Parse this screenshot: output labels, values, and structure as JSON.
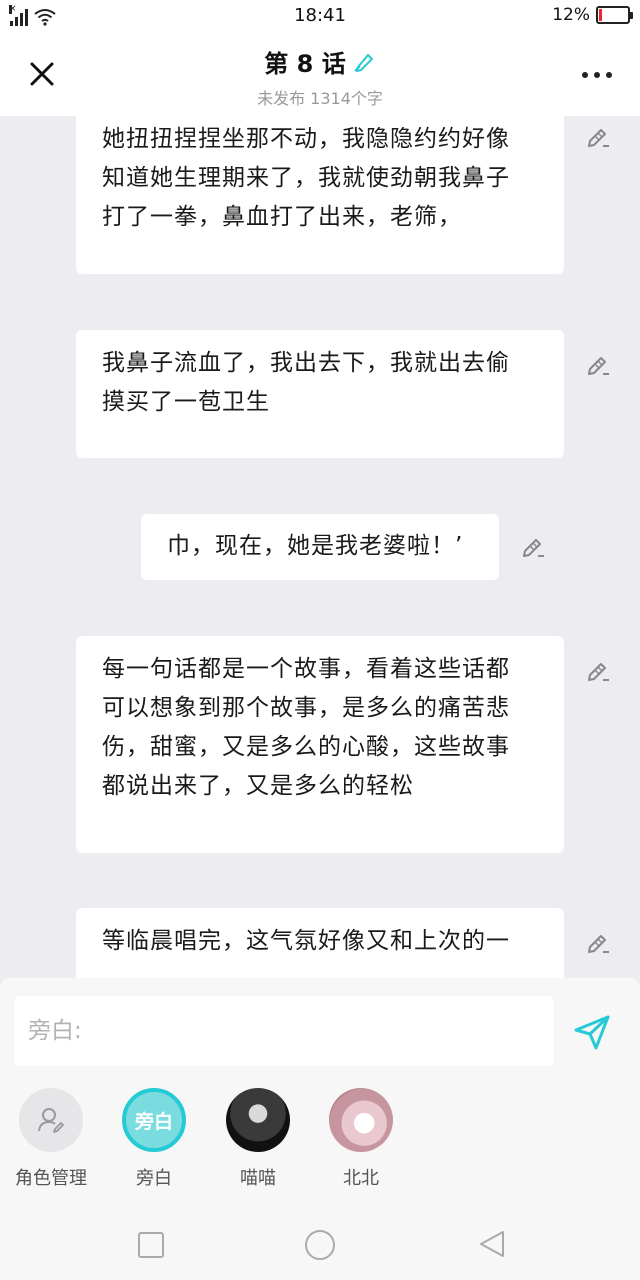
{
  "status_bar": {
    "time": "18:41",
    "battery_percent": "12%",
    "battery_level": 0.12,
    "battery_color": "#e8262b"
  },
  "header": {
    "title": "第 8 话",
    "subtitle": "未发布 1314个字",
    "close_icon": "close-icon",
    "title_edit_icon": "pencil-icon",
    "more_icon": "more-dots-icon"
  },
  "messages": [
    {
      "speaker": "narration",
      "text": [
        "她扭扭捏捏坐那不动，我隐隐约约好像",
        "知道她生理期来了，我就使劲朝我鼻子",
        "打了一拳，鼻血打了出来，老筛，"
      ]
    },
    {
      "speaker": "narration",
      "text": [
        "我鼻子流血了，我出去下，我就出去偷",
        "摸买了一苞卫生"
      ]
    },
    {
      "speaker": "narration",
      "text": [
        "巾，现在，她是我老婆啦！’"
      ]
    },
    {
      "speaker": "narration",
      "text": [
        "每一句话都是一个故事，看着这些话都",
        "可以想象到那个故事，是多么的痛苦悲",
        "伤，甜蜜，又是多么的心酸，这些故事",
        "都说出来了，又是多么的轻松"
      ]
    },
    {
      "speaker": "narration",
      "text": [
        "等临晨唱完，这气氛好像又和上次的一"
      ]
    }
  ],
  "input": {
    "placeholder": "旁白:",
    "value": "",
    "send_icon": "send-icon"
  },
  "roles": [
    {
      "label": "角色管理",
      "icon": "role-manage-icon",
      "selected": false
    },
    {
      "label": "旁白",
      "avatar_text": "旁白",
      "selected": true
    },
    {
      "label": "喵喵",
      "icon": "avatar-photo",
      "selected": false
    },
    {
      "label": "北北",
      "icon": "avatar-photo",
      "selected": false
    }
  ],
  "accent_color": "#25cad4",
  "nav": [
    "square-icon",
    "circle-icon",
    "back-triangle-icon"
  ]
}
